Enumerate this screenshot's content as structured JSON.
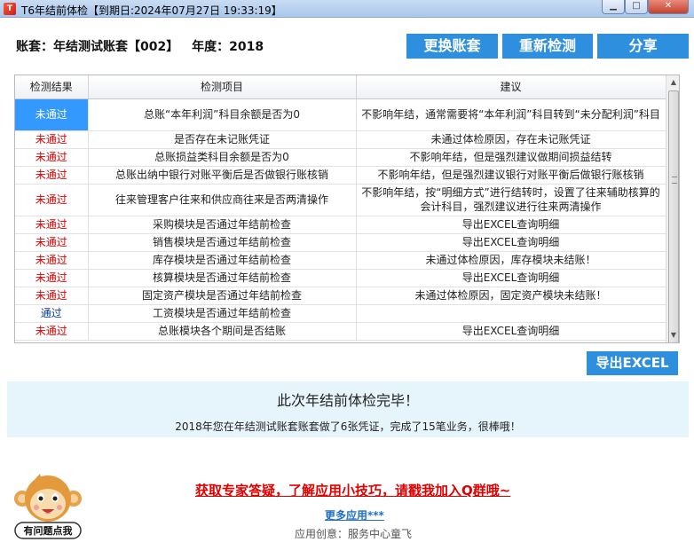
{
  "window": {
    "title": "T6年结前体检【到期日:2024年07月27日 19:33:19】",
    "min_icon": "minimize-icon",
    "max_icon": "maximize-icon",
    "close_icon": "close-icon"
  },
  "header": {
    "account_label": "账套：",
    "account_name": "年结测试账套【002】",
    "year_label": "年度：",
    "year": "2018",
    "btn_change": "更换账套",
    "btn_recheck": "重新检测",
    "btn_share": "分享"
  },
  "table": {
    "columns": [
      "检测结果",
      "检测项目",
      "建议"
    ],
    "rows": [
      {
        "status": "未通过",
        "pass": false,
        "item": "总账“本年利润”科目余额是否为0",
        "advice": "不影响年结，通常需要将“本年利润”科目转到“未分配利润”科目"
      },
      {
        "status": "未通过",
        "pass": false,
        "item": "是否存在未记账凭证",
        "advice": "未通过体检原因，存在未记账凭证"
      },
      {
        "status": "未通过",
        "pass": false,
        "item": "总账损益类科目余额是否为0",
        "advice": "不影响年结，但是强烈建议做期间损益结转"
      },
      {
        "status": "未通过",
        "pass": false,
        "item": "总账出纳中银行对账平衡后是否做银行账核销",
        "advice": "不影响年结，但是强烈建议银行对账平衡后做银行账核销"
      },
      {
        "status": "未通过",
        "pass": false,
        "item": "往来管理客户往来和供应商往来是否两清操作",
        "advice": "不影响年结，按“明细方式”进行结转时，设置了往来辅助核算的会计科目，强烈建议进行往来两清操作"
      },
      {
        "status": "未通过",
        "pass": false,
        "item": "采购模块是否通过年结前检查",
        "advice": "导出EXCEL查询明细"
      },
      {
        "status": "未通过",
        "pass": false,
        "item": "销售模块是否通过年结前检查",
        "advice": "导出EXCEL查询明细"
      },
      {
        "status": "未通过",
        "pass": false,
        "item": "库存模块是否通过年结前检查",
        "advice": "未通过体检原因，库存模块未结账！"
      },
      {
        "status": "未通过",
        "pass": false,
        "item": "核算模块是否通过年结前检查",
        "advice": "导出EXCEL查询明细"
      },
      {
        "status": "未通过",
        "pass": false,
        "item": "固定资产模块是否通过年结前检查",
        "advice": "未通过体检原因，固定资产模块未结账！"
      },
      {
        "status": "通过",
        "pass": true,
        "item": "工资模块是否通过年结前检查",
        "advice": ""
      },
      {
        "status": "未通过",
        "pass": false,
        "item": "总账模块各个期间是否结账",
        "advice": "导出EXCEL查询明细"
      }
    ]
  },
  "export_button": "导出EXCEL",
  "summary": {
    "title": "此次年结前体检完毕！",
    "text": "2018年您在年结测试账套账套做了6张凭证，完成了15笔业务，很棒哦！"
  },
  "footer": {
    "mascot_label": "有问题点我",
    "qq_link": "获取专家答疑，了解应用小技巧，请戳我加入Q群哦~",
    "more_link": "更多应用***",
    "credit": "应用创意：服务中心童飞"
  }
}
